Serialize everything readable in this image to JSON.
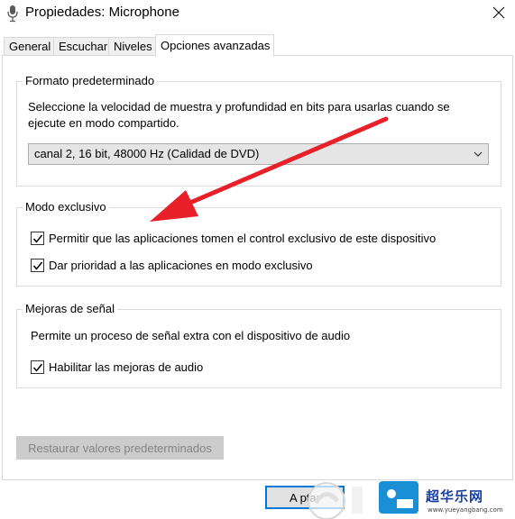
{
  "window": {
    "title": "Propiedades: Microphone",
    "close_icon": "close-icon",
    "app_icon": "microphone-icon"
  },
  "tabs": [
    {
      "label": "General",
      "active": false
    },
    {
      "label": "Escuchar",
      "active": false
    },
    {
      "label": "Niveles",
      "active": false
    },
    {
      "label": "Opciones avanzadas",
      "active": true
    }
  ],
  "default_format": {
    "legend": "Formato predeterminado",
    "description_line1": "Seleccione la velocidad de muestra y profundidad en bits para usarlas cuando se",
    "description_line2": "ejecute en modo compartido.",
    "selected_value": "canal 2, 16 bit, 48000 Hz (Calidad de DVD)"
  },
  "exclusive_mode": {
    "legend": "Modo exclusivo",
    "option1": {
      "label": "Permitir que las aplicaciones tomen el control exclusivo de este dispositivo",
      "checked": true
    },
    "option2": {
      "label": "Dar prioridad a las aplicaciones en modo exclusivo",
      "checked": true
    }
  },
  "signal_enhancements": {
    "legend": "Mejoras de señal",
    "description": "Permite un proceso de señal extra con el dispositivo de audio",
    "option": {
      "label": "Habilitar las mejoras de audio",
      "checked": true
    }
  },
  "buttons": {
    "restore_defaults": "Restaurar valores predeterminados",
    "accept": "Aceptar",
    "accept_visible": "A  ptar"
  },
  "annotation": {
    "arrow_color": "#e8202a"
  },
  "watermark": {
    "text": "超华乐网",
    "url": "www.yueyangbang.com"
  }
}
